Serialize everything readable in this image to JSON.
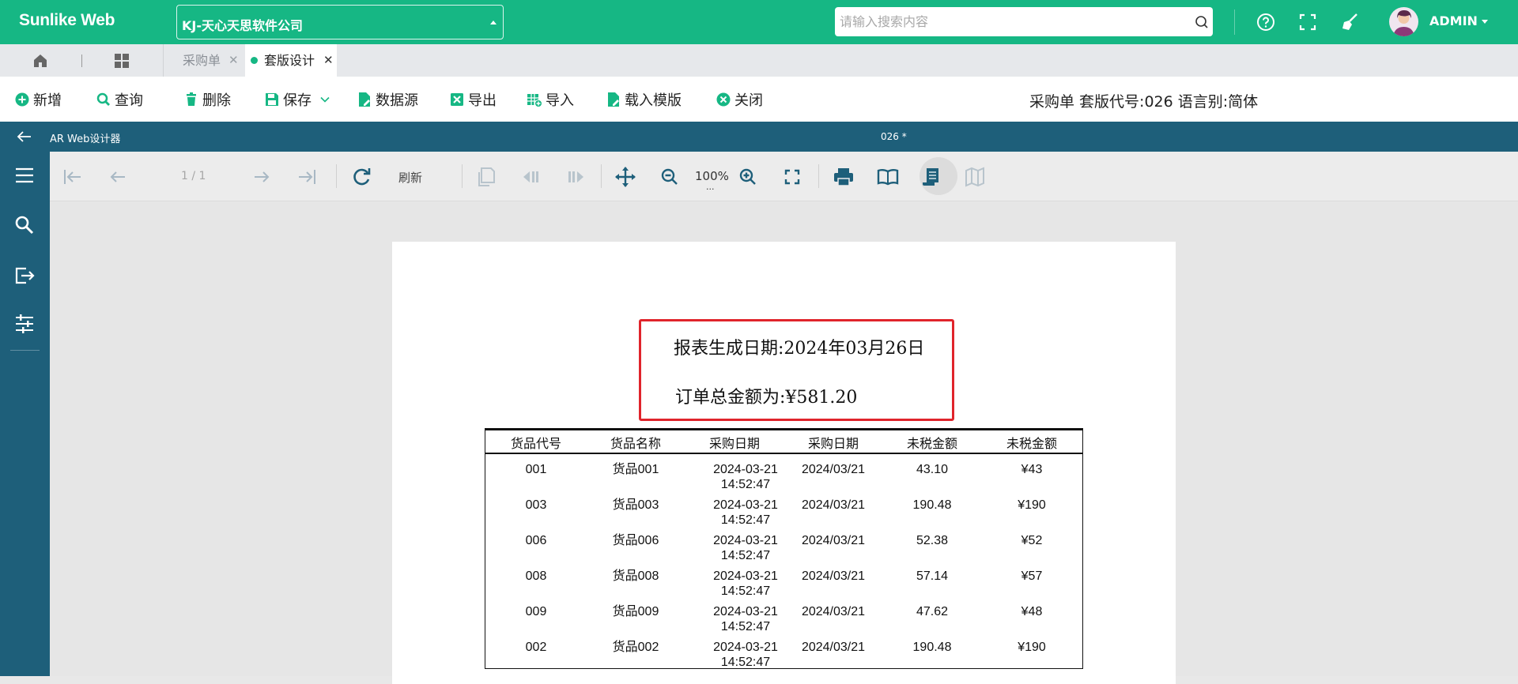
{
  "header": {
    "brand": "Sunlike Web",
    "company": "KJ-天心天思软件公司",
    "search_placeholder": "请输入搜索内容",
    "user": "ADMIN"
  },
  "tabs": {
    "items": [
      {
        "label": "采购单",
        "active": false
      },
      {
        "label": "套版设计",
        "active": true
      }
    ]
  },
  "actions": {
    "new": "新增",
    "query": "查询",
    "delete": "删除",
    "save": "保存",
    "datasource": "数据源",
    "export": "导出",
    "import": "导入",
    "load_template": "载入模版",
    "close": "关闭",
    "info": "采购单 套版代号:026 语言别:简体"
  },
  "designer": {
    "title": "AR Web设计器",
    "doc": "026 *"
  },
  "viewer": {
    "page": "1 / 1",
    "refresh": "刷新",
    "zoom": "100%",
    "zoom_more": "..."
  },
  "report": {
    "gen_date": "报表生成日期:2024年03月26日",
    "total": "订单总金额为:¥581.20",
    "columns": [
      "货品代号",
      "货品名称",
      "采购日期",
      "采购日期",
      "未税金额",
      "未税金额"
    ],
    "rows": [
      {
        "code": "001",
        "name": "货品001",
        "dt1": "2024-03-21",
        "dt2": "14:52:47",
        "date": "2024/03/21",
        "amt": "43.10",
        "amt2": "¥43"
      },
      {
        "code": "003",
        "name": "货品003",
        "dt1": "2024-03-21",
        "dt2": "14:52:47",
        "date": "2024/03/21",
        "amt": "190.48",
        "amt2": "¥190"
      },
      {
        "code": "006",
        "name": "货品006",
        "dt1": "2024-03-21",
        "dt2": "14:52:47",
        "date": "2024/03/21",
        "amt": "52.38",
        "amt2": "¥52"
      },
      {
        "code": "008",
        "name": "货品008",
        "dt1": "2024-03-21",
        "dt2": "14:52:47",
        "date": "2024/03/21",
        "amt": "57.14",
        "amt2": "¥57"
      },
      {
        "code": "009",
        "name": "货品009",
        "dt1": "2024-03-21",
        "dt2": "14:52:47",
        "date": "2024/03/21",
        "amt": "47.62",
        "amt2": "¥48"
      },
      {
        "code": "002",
        "name": "货品002",
        "dt1": "2024-03-21",
        "dt2": "14:52:47",
        "date": "2024/03/21",
        "amt": "190.48",
        "amt2": "¥190"
      }
    ]
  },
  "colors": {
    "brand_green": "#16b784",
    "designer_blue": "#1e5f7a",
    "highlight_red": "#e0242b"
  }
}
